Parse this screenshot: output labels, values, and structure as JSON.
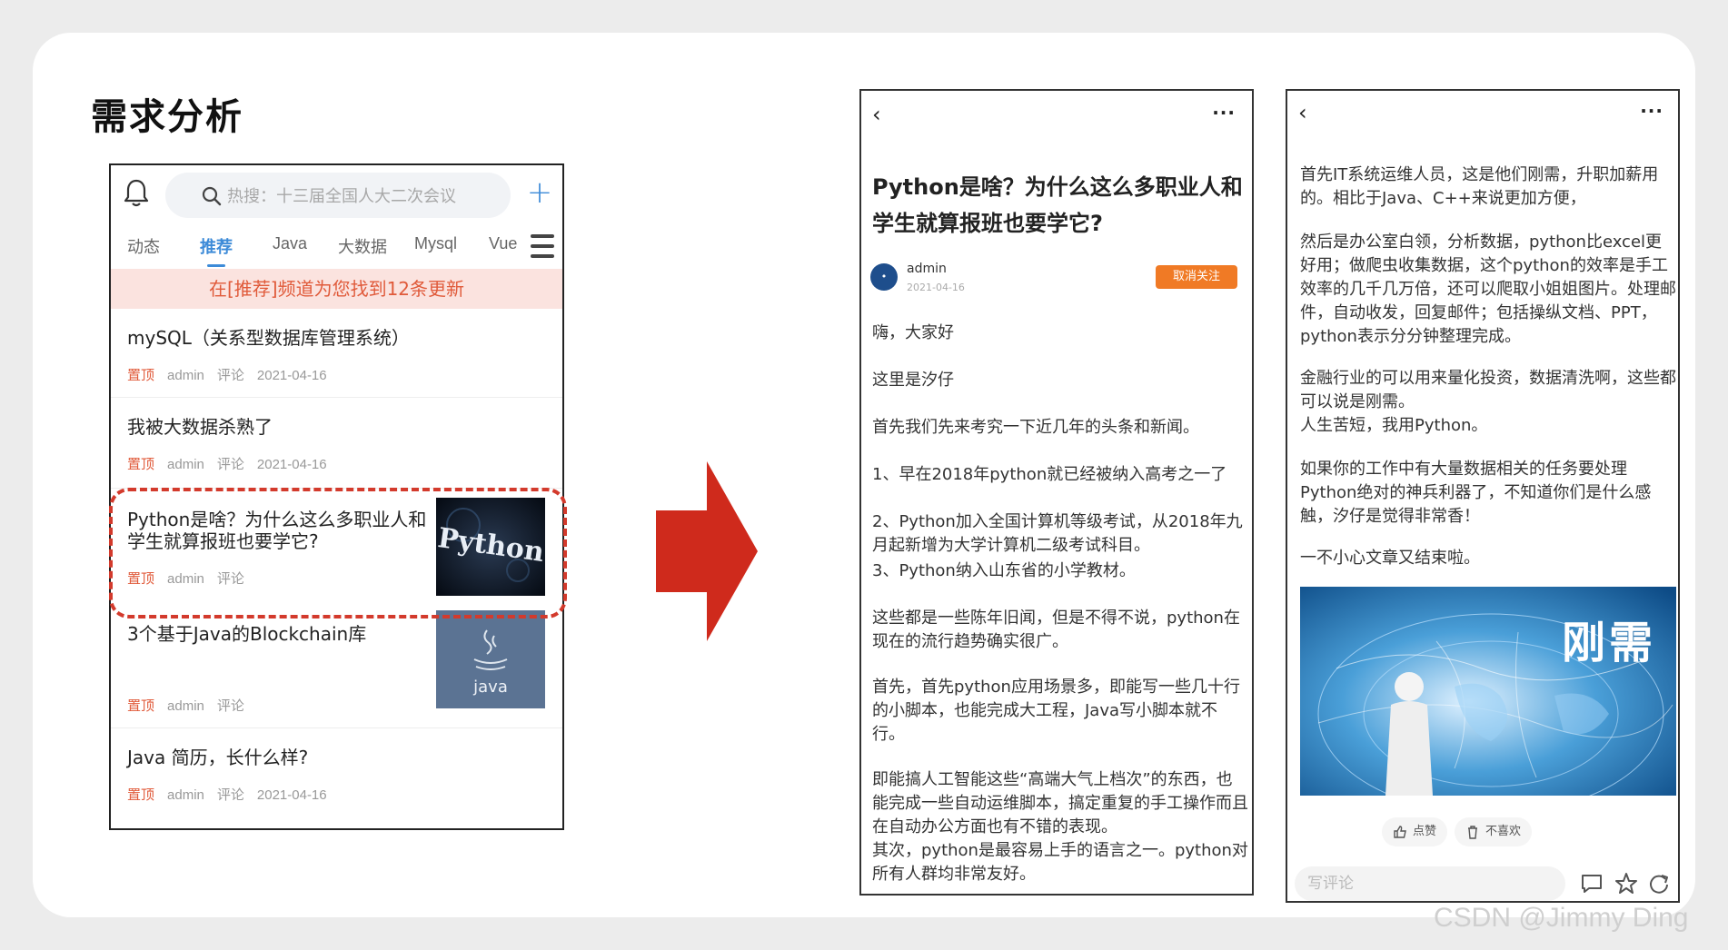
{
  "slide": {
    "title": "需求分析"
  },
  "feed": {
    "search_placeholder": "热搜：十三届全国人大二次会议",
    "tabs": [
      {
        "label": "动态",
        "active": false
      },
      {
        "label": "推荐",
        "active": true
      },
      {
        "label": "Java",
        "active": false
      },
      {
        "label": "大数据",
        "active": false
      },
      {
        "label": "Mysql",
        "active": false
      },
      {
        "label": "Vue",
        "active": false
      }
    ],
    "notice": "在[推荐]频道为您找到12条更新",
    "articles": [
      {
        "title": "mySQL（关系型数据库管理系统）",
        "pin": "置顶",
        "author": "admin",
        "comment": "评论",
        "date": "2021-04-16"
      },
      {
        "title": "我被大数据杀熟了",
        "pin": "置顶",
        "author": "admin",
        "comment": "评论",
        "date": "2021-04-16"
      },
      {
        "title": "Python是啥？为什么这么多职业人和学生就算报班也要学它?",
        "pin": "置顶",
        "author": "admin",
        "comment": "评论",
        "thumb": "Python"
      },
      {
        "title": "3个基于Java的Blockchain库",
        "pin": "置顶",
        "author": "admin",
        "comment": "评论",
        "thumb": "java"
      },
      {
        "title": "Java 简历，长什么样?",
        "pin": "置顶",
        "author": "admin",
        "comment": "评论",
        "date": "2021-04-16"
      }
    ]
  },
  "detail": {
    "title": "Python是啥？为什么这么多职业人和学生就算报班也要学它?",
    "author": "admin",
    "date": "2021-04-16",
    "follow_button": "取消关注",
    "paragraphs": [
      "嗨，大家好",
      "这里是汐仔",
      "首先我们先来考究一下近几年的头条和新闻。",
      "1、早在2018年python就已经被纳入高考之一了",
      "2、Python加入全国计算机等级考试，从2018年九月起新增为大学计算机二级考试科目。",
      "3、Python纳入山东省的小学教材。",
      "这些都是一些陈年旧闻，但是不得不说，python在现在的流行趋势确实很广。",
      "首先，首先python应用场景多，即能写一些几十行的小脚本，也能完成大工程，Java写小脚本就不行。",
      "即能搞人工智能这些“高端大气上档次”的东西，也能完成一些自动运维脚本，搞定重复的手工操作而且在自动办公方面也有不错的表现。",
      "其次，python是最容易上手的语言之一。python对所有人群均非常友好。"
    ]
  },
  "detail2": {
    "paragraphs": [
      "首先IT系统运维人员，这是他们刚需，升职加薪用的。相比于Java、C++来说更加方便，",
      "然后是办公室白领，分析数据，python比excel更好用；做爬虫收集数据，这个python的效率是手工效率的几千几万倍，还可以爬取小姐姐图片。处理邮件，自动收发，回复邮件；包括操纵文档、PPT，python表示分分钟整理完成。",
      "金融行业的可以用来量化投资，数据清洗啊，这些都可以说是刚需。",
      "人生苦短，我用Python。",
      "如果你的工作中有大量数据相关的任务要处理Python绝对的神兵利器了，不知道你们是什么感触，汐仔是觉得非常香！",
      "一不小心文章又结束啦。"
    ],
    "image_caption": "刚需",
    "like_label": "点赞",
    "dislike_label": "不喜欢",
    "comment_placeholder": "写评论"
  },
  "watermark": "CSDN @Jimmy Ding",
  "colors": {
    "accent": "#3d8bd8",
    "highlight": "#d33a2c",
    "follow": "#f07a25",
    "pin": "#e05a3a"
  }
}
